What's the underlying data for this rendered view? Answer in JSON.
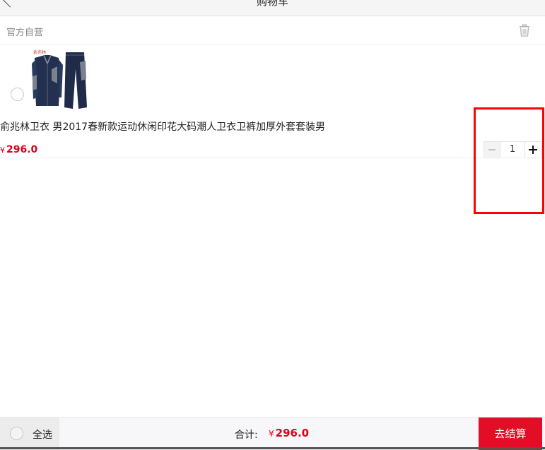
{
  "header": {
    "title": "购物车"
  },
  "shop": {
    "name": "官方自营"
  },
  "cart_items": [
    {
      "name": "俞兆林卫衣 男2017春新款运动休闲印花大码潮人卫衣卫裤加厚外套套装男",
      "currency": "¥",
      "price": "296.0",
      "quantity": "1",
      "image_brand_text": "俞兆林",
      "image_color": "#23304f"
    }
  ],
  "footer": {
    "select_all_label": "全选",
    "total_label": "合计:",
    "currency": "¥",
    "total_amount": "296.0",
    "checkout_label": "去结算"
  },
  "colors": {
    "accent": "#e20e25",
    "price": "#e0001c",
    "highlight": "#ff0000"
  },
  "icons": {
    "back": "chevron-left-icon",
    "trash": "trash-icon",
    "minus": "minus-icon",
    "plus": "plus-icon"
  }
}
